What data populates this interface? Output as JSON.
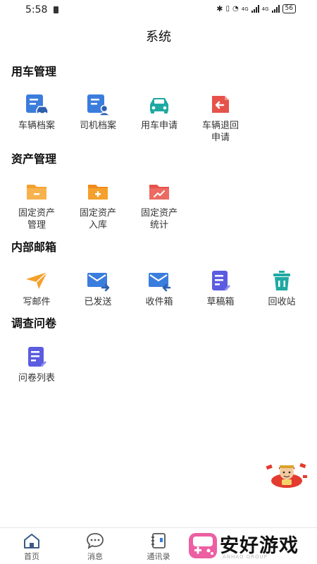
{
  "status_bar": {
    "time": "5:58",
    "network": "4G",
    "battery": "56"
  },
  "page": {
    "title": "系统"
  },
  "sections": [
    {
      "title": "用车管理",
      "items": [
        {
          "label": "车辆档案",
          "icon": "car-file-icon"
        },
        {
          "label": "司机档案",
          "icon": "driver-file-icon"
        },
        {
          "label": "用车申请",
          "icon": "car-icon"
        },
        {
          "label": "车辆退回\n申请",
          "icon": "return-icon"
        }
      ]
    },
    {
      "title": "资产管理",
      "items": [
        {
          "label": "固定资产\n管理",
          "icon": "folder-minus-icon"
        },
        {
          "label": "固定资产\n入库",
          "icon": "folder-plus-icon"
        },
        {
          "label": "固定资产\n统计",
          "icon": "folder-chart-icon"
        }
      ]
    },
    {
      "title": "内部邮箱",
      "items": [
        {
          "label": "写邮件",
          "icon": "send-icon"
        },
        {
          "label": "已发送",
          "icon": "mail-sent-icon"
        },
        {
          "label": "收件箱",
          "icon": "inbox-icon"
        },
        {
          "label": "草稿箱",
          "icon": "draft-icon"
        },
        {
          "label": "回收站",
          "icon": "trash-icon"
        }
      ]
    },
    {
      "title": "调查问卷",
      "items": [
        {
          "label": "问卷列表",
          "icon": "survey-list-icon"
        }
      ]
    }
  ],
  "tab_bar": {
    "items": [
      {
        "label": "首页",
        "icon": "home-icon"
      },
      {
        "label": "消息",
        "icon": "message-icon"
      },
      {
        "label": "通讯录",
        "icon": "contacts-icon"
      }
    ]
  },
  "watermark": {
    "text": "安好游戏",
    "sub": "ANHAO GROUP"
  },
  "colors": {
    "blue": "#3b7ddd",
    "teal": "#1fa9a2",
    "red": "#e5534b",
    "orange": "#f5a02c",
    "purple": "#5b5ce0",
    "pink": "#ec5fa2"
  }
}
